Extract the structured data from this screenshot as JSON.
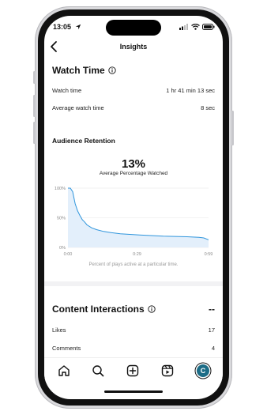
{
  "status": {
    "time": "13:05"
  },
  "header": {
    "title": "Insights"
  },
  "watch_time": {
    "title": "Watch Time",
    "rows": [
      {
        "label": "Watch time",
        "value": "1 hr 41 min 13 sec"
      },
      {
        "label": "Average watch time",
        "value": "8 sec"
      }
    ]
  },
  "retention": {
    "title": "Audience Retention",
    "percent": "13%",
    "percent_caption": "Average Percentage Watched",
    "caption": "Percent of plays active at a particular time."
  },
  "chart_data": {
    "type": "area",
    "x": [
      0,
      1,
      2,
      3,
      4,
      5,
      6,
      7,
      8,
      10,
      12,
      15,
      18,
      22,
      26,
      30,
      35,
      40,
      45,
      50,
      55,
      57,
      59
    ],
    "x_unit": "seconds",
    "series": [
      {
        "values": [
          100,
          100,
          94,
          74,
          62,
          54,
          47,
          43,
          38,
          33,
          30,
          27,
          25,
          23,
          22,
          21,
          20,
          19,
          18.5,
          18,
          17,
          16,
          13
        ]
      }
    ],
    "ylim": [
      0,
      100
    ],
    "xlim": [
      0,
      59
    ],
    "yticks": [
      "100%",
      "50%",
      "0%"
    ],
    "ytick_values": [
      100,
      50,
      0
    ],
    "xticks": [
      "0:00",
      "0:29",
      "0:59"
    ],
    "xtick_values": [
      0,
      29,
      59
    ],
    "grid": true,
    "colors": {
      "line": "#2f95dc",
      "fill": "#e3effb",
      "grid": "#e6e6e6"
    }
  },
  "content_interactions": {
    "title": "Content Interactions",
    "value": "--",
    "rows": [
      {
        "label": "Likes",
        "value": "17"
      },
      {
        "label": "Comments",
        "value": "4"
      }
    ]
  },
  "tab_bar": {
    "items": [
      "home-icon",
      "search-icon",
      "create-icon",
      "reels-icon",
      "profile-avatar"
    ],
    "avatar_letter": "C",
    "avatar_color": "#1c6c86"
  }
}
